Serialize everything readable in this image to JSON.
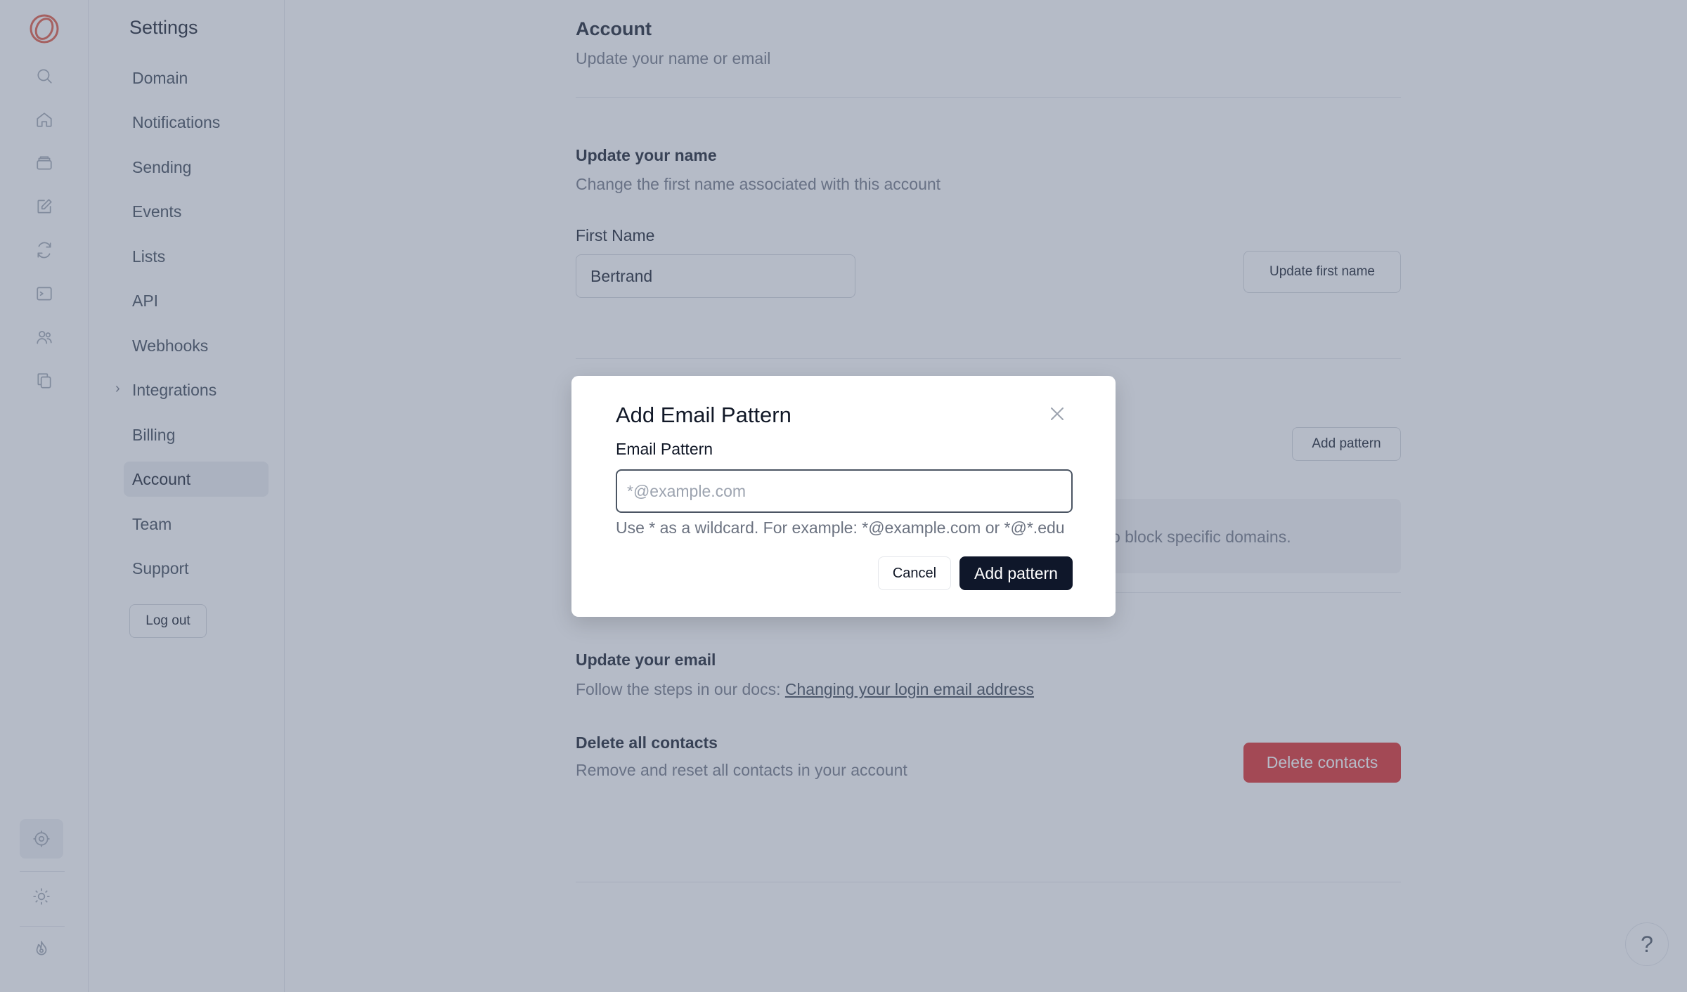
{
  "sidebar": {
    "title": "Settings",
    "items": [
      {
        "label": "Domain"
      },
      {
        "label": "Notifications"
      },
      {
        "label": "Sending"
      },
      {
        "label": "Events"
      },
      {
        "label": "Lists"
      },
      {
        "label": "API"
      },
      {
        "label": "Webhooks"
      },
      {
        "label": "Integrations"
      },
      {
        "label": "Billing"
      },
      {
        "label": "Account"
      },
      {
        "label": "Team"
      },
      {
        "label": "Support"
      }
    ],
    "active_item": "Account",
    "logout_label": "Log out"
  },
  "rail": {
    "icons": [
      "logo-icon",
      "search-icon",
      "home-icon",
      "inbox-icon",
      "edit-icon",
      "refresh-icon",
      "terminal-icon",
      "users-icon",
      "copy-icon",
      "settings-icon",
      "sun-icon",
      "flame-icon"
    ],
    "brand_color": "#e0533d"
  },
  "account": {
    "title": "Account",
    "subtitle": "Update your name or email",
    "name_section": {
      "title": "Update your name",
      "subtitle": "Change the first name associated with this account",
      "field_label": "First Name",
      "field_value": "Bertrand",
      "button_label": "Update first name"
    },
    "pattern_section": {
      "button_label": "Add pattern",
      "info_text_partial": "m to block specific domains."
    },
    "email_section": {
      "title": "Update your email",
      "text": "Follow the steps in our docs: ",
      "link_text": "Changing your login email address"
    },
    "delete_section": {
      "title": "Delete all contacts",
      "subtitle": "Remove and reset all contacts in your account",
      "button_label": "Delete contacts",
      "button_color": "#dc2626"
    }
  },
  "modal": {
    "title": "Add Email Pattern",
    "field_label": "Email Pattern",
    "placeholder": "*@example.com",
    "value": "",
    "hint": "Use * as a wildcard. For example: *@example.com or *@*.edu",
    "cancel_label": "Cancel",
    "submit_label": "Add pattern"
  },
  "help": {
    "label": "?"
  }
}
